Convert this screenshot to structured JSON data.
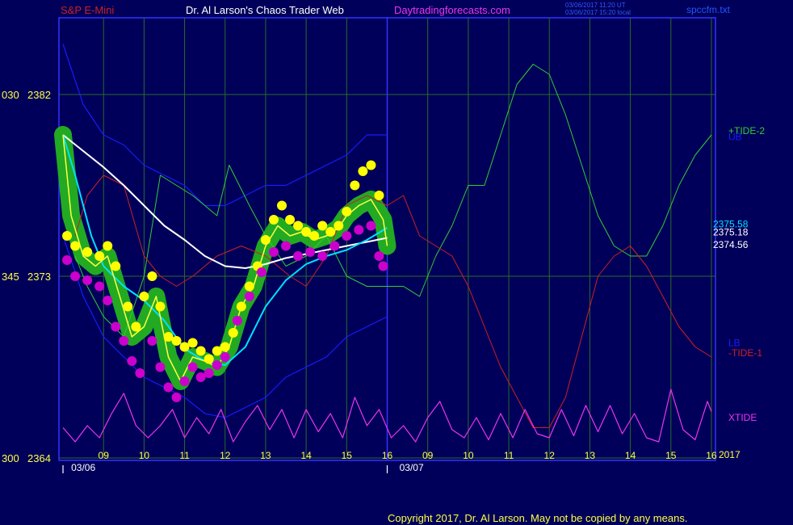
{
  "header": {
    "symbol": "S&P E-Mini",
    "author": "Dr. Al Larson's Chaos Trader Web",
    "site": "Daytradingforecasts.com",
    "stamp1": "03/06/2017 11:20 UT",
    "stamp2": "03/06/2017 15:20 local",
    "file": "spccfm.txt"
  },
  "footer": {
    "copyright": "Copyright 2017, Dr. Al Larson. May not be copied by any means."
  },
  "colors": {
    "background": "#00005a",
    "frame": "#3333ff",
    "grid": "#2a6a2a",
    "tide2": "#33cc33",
    "tide1": "#cc2020",
    "xtide": "#ee33ee",
    "band": "#1a1aff",
    "ma_slow": "#ffffff",
    "ma_mid": "#00e0ff",
    "price": "#ffff44",
    "halo": "#22aa22",
    "high_dot": "#ffff00",
    "low_dot": "#cc00cc"
  },
  "chart_data": {
    "type": "line",
    "y_axis": {
      "ylim": [
        2364,
        2385
      ],
      "ticks": [
        {
          "value": 2382,
          "label": "2382",
          "prefix": "030"
        },
        {
          "value": 2373,
          "label": "2373",
          "prefix": "345"
        },
        {
          "value": 2364,
          "label": "2364",
          "prefix": "300"
        }
      ]
    },
    "x_axis": {
      "xlim": [
        7.9,
        24.1
      ],
      "hour_ticks": [
        {
          "x": 9,
          "label": "09"
        },
        {
          "x": 10,
          "label": "10"
        },
        {
          "x": 11,
          "label": "11"
        },
        {
          "x": 12,
          "label": "12"
        },
        {
          "x": 13,
          "label": "13"
        },
        {
          "x": 14,
          "label": "14"
        },
        {
          "x": 15,
          "label": "15"
        },
        {
          "x": 16,
          "label": "16"
        },
        {
          "x": 17,
          "label": "09"
        },
        {
          "x": 18,
          "label": "10"
        },
        {
          "x": 19,
          "label": "11"
        },
        {
          "x": 20,
          "label": "12"
        },
        {
          "x": 21,
          "label": "13"
        },
        {
          "x": 22,
          "label": "14"
        },
        {
          "x": 23,
          "label": "15"
        },
        {
          "x": 24,
          "label": "16"
        }
      ],
      "date_labels": [
        {
          "x": 8.5,
          "label": "03/06"
        },
        {
          "x": 16.6,
          "label": "03/07"
        }
      ],
      "divider_x": 16,
      "year_label": "2017"
    },
    "value_labels": [
      {
        "value": 2375.58,
        "label": "2375.58",
        "color": "#00e0ff"
      },
      {
        "value": 2375.18,
        "label": "2375.18",
        "color": "#ffffff"
      },
      {
        "value": 2374.56,
        "label": "2374.56",
        "color": "#ffffff"
      }
    ],
    "series": [
      {
        "name": "+TIDE-2",
        "color": "#33cc33",
        "legend_y": 2380.2,
        "x": [
          8.3,
          8.6,
          9.0,
          9.5,
          10.0,
          10.4,
          10.8,
          11.2,
          11.8,
          12.1,
          12.6,
          13.0,
          13.5,
          14.0,
          14.5,
          15.0,
          15.5,
          16.0,
          16.4,
          16.8,
          17.2,
          17.6,
          18.0,
          18.4,
          18.8,
          19.2,
          19.6,
          20.0,
          20.4,
          20.8,
          21.2,
          21.6,
          22.0,
          22.4,
          22.8,
          23.2,
          23.6,
          24.0
        ],
        "y": [
          2374.0,
          2372.5,
          2371.0,
          2370.0,
          2373.0,
          2378.0,
          2377.5,
          2377.0,
          2376.0,
          2378.5,
          2376.5,
          2375.0,
          2373.5,
          2374.0,
          2375.0,
          2373.0,
          2372.5,
          2372.5,
          2372.5,
          2372.0,
          2374.0,
          2375.5,
          2377.5,
          2377.5,
          2380.0,
          2382.5,
          2383.5,
          2383.0,
          2381.0,
          2378.5,
          2376.0,
          2374.5,
          2374.0,
          2374.0,
          2375.5,
          2377.5,
          2379.0,
          2380.0
        ]
      },
      {
        "name": "-TIDE-1",
        "color": "#cc2020",
        "legend_y": 2369.2,
        "x": [
          8.3,
          8.6,
          9.0,
          9.5,
          10.0,
          10.4,
          10.8,
          11.2,
          11.8,
          12.4,
          13.0,
          13.6,
          14.0,
          14.5,
          15.0,
          15.5,
          16.0,
          16.4,
          16.8,
          17.2,
          17.6,
          18.0,
          18.4,
          18.8,
          19.2,
          19.6,
          20.0,
          20.4,
          20.8,
          21.2,
          21.6,
          22.0,
          22.4,
          22.8,
          23.2,
          23.6,
          24.0
        ],
        "y": [
          2375.0,
          2377.0,
          2378.0,
          2377.5,
          2374.0,
          2373.0,
          2372.5,
          2373.0,
          2374.0,
          2374.5,
          2374.0,
          2373.0,
          2372.5,
          2374.0,
          2376.5,
          2377.0,
          2376.5,
          2377.0,
          2375.0,
          2374.5,
          2374.0,
          2372.5,
          2370.5,
          2368.5,
          2367.0,
          2365.5,
          2365.5,
          2367.0,
          2370.0,
          2373.0,
          2374.0,
          2374.5,
          2373.5,
          2372.0,
          2370.5,
          2369.5,
          2369.0
        ]
      },
      {
        "name": "XTIDE",
        "color": "#ee33ee",
        "legend_y": 2366.0,
        "x": [
          8.0,
          8.3,
          8.6,
          8.9,
          9.2,
          9.5,
          9.8,
          10.1,
          10.4,
          10.7,
          11.0,
          11.3,
          11.6,
          11.9,
          12.2,
          12.5,
          12.8,
          13.1,
          13.4,
          13.7,
          14.0,
          14.3,
          14.6,
          14.9,
          15.2,
          15.5,
          15.8,
          16.1,
          16.4,
          16.7,
          17.0,
          17.3,
          17.6,
          17.9,
          18.2,
          18.5,
          18.8,
          19.1,
          19.4,
          19.7,
          20.0,
          20.3,
          20.6,
          20.9,
          21.2,
          21.5,
          21.8,
          22.1,
          22.4,
          22.7,
          23.0,
          23.3,
          23.6,
          23.9,
          24.0
        ],
        "y": [
          2365.5,
          2364.8,
          2365.6,
          2365.0,
          2366.2,
          2367.2,
          2365.6,
          2365.0,
          2365.6,
          2366.4,
          2365.0,
          2366.0,
          2365.2,
          2366.4,
          2364.8,
          2365.8,
          2366.6,
          2365.4,
          2366.4,
          2365.0,
          2366.4,
          2365.3,
          2366.2,
          2365.0,
          2367.0,
          2365.6,
          2366.4,
          2365.0,
          2365.6,
          2364.8,
          2366.0,
          2366.8,
          2365.4,
          2365.0,
          2366.0,
          2364.9,
          2366.2,
          2365.0,
          2366.4,
          2365.2,
          2365.0,
          2366.4,
          2365.1,
          2366.6,
          2365.3,
          2366.6,
          2365.2,
          2366.2,
          2365.0,
          2364.8,
          2367.4,
          2365.4,
          2364.9,
          2366.8,
          2366.3
        ]
      },
      {
        "name": "UB",
        "color": "#1a1aff",
        "legend_y": 2379.9,
        "x": [
          8.0,
          8.5,
          9.0,
          9.5,
          10.0,
          10.5,
          11.0,
          11.5,
          12.0,
          12.5,
          13.0,
          13.5,
          14.0,
          14.5,
          15.0,
          15.5,
          16.0
        ],
        "y": [
          2384.5,
          2381.5,
          2380.0,
          2379.5,
          2378.5,
          2378.0,
          2377.5,
          2376.5,
          2376.5,
          2377.0,
          2377.5,
          2377.5,
          2378.0,
          2378.5,
          2379.0,
          2380.0,
          2380.0
        ]
      },
      {
        "name": "LB",
        "color": "#1a1aff",
        "legend_y": 2369.7,
        "x": [
          8.0,
          8.5,
          9.0,
          9.5,
          10.0,
          10.5,
          11.0,
          11.5,
          12.0,
          12.5,
          13.0,
          13.5,
          14.0,
          14.5,
          15.0,
          15.5,
          16.0
        ],
        "y": [
          2375.0,
          2372.0,
          2370.0,
          2369.0,
          2368.0,
          2367.5,
          2367.0,
          2366.2,
          2366.0,
          2366.5,
          2367.0,
          2368.0,
          2368.5,
          2369.0,
          2370.0,
          2370.5,
          2371.0
        ]
      },
      {
        "name": "",
        "color": "#ffffff",
        "x": [
          8.0,
          8.5,
          9.0,
          9.5,
          10.0,
          10.5,
          11.0,
          11.5,
          12.0,
          12.5,
          13.0,
          13.5,
          14.0,
          14.5,
          15.0,
          15.5,
          16.0
        ],
        "y": [
          2380.0,
          2379.2,
          2378.4,
          2377.5,
          2376.5,
          2375.5,
          2374.8,
          2374.0,
          2373.5,
          2373.4,
          2373.6,
          2373.9,
          2374.1,
          2374.3,
          2374.5,
          2374.7,
          2374.9
        ]
      },
      {
        "name": "",
        "color": "#00e0ff",
        "x": [
          8.0,
          8.3,
          8.7,
          9.0,
          9.5,
          10.0,
          10.5,
          11.0,
          11.5,
          12.0,
          12.5,
          13.0,
          13.5,
          14.0,
          14.5,
          15.0,
          15.5,
          16.0
        ],
        "y": [
          2380.0,
          2378.0,
          2375.0,
          2373.5,
          2372.5,
          2371.8,
          2370.8,
          2369.4,
          2368.8,
          2368.6,
          2369.5,
          2371.5,
          2372.8,
          2373.6,
          2374.0,
          2374.3,
          2374.8,
          2375.4
        ]
      },
      {
        "name": "",
        "color": "#ffff44",
        "x": [
          8.0,
          8.2,
          8.5,
          8.8,
          9.1,
          9.4,
          9.7,
          10.0,
          10.3,
          10.6,
          10.9,
          11.2,
          11.5,
          11.8,
          12.1,
          12.4,
          12.7,
          13.0,
          13.3,
          13.6,
          13.9,
          14.2,
          14.5,
          14.8,
          15.0,
          15.3,
          15.6,
          15.9,
          16.0
        ],
        "y": [
          2380.0,
          2376.0,
          2374.0,
          2373.5,
          2374.0,
          2372.0,
          2370.0,
          2370.5,
          2372.0,
          2369.0,
          2367.8,
          2369.0,
          2368.8,
          2368.5,
          2369.5,
          2371.5,
          2372.5,
          2374.5,
          2375.5,
          2375.0,
          2375.2,
          2374.8,
          2375.0,
          2375.4,
          2376.0,
          2376.5,
          2376.8,
          2375.8,
          2374.5
        ]
      }
    ],
    "highs": [
      [
        8.1,
        2375.0
      ],
      [
        8.3,
        2374.5
      ],
      [
        8.6,
        2374.2
      ],
      [
        8.9,
        2374.0
      ],
      [
        9.1,
        2374.5
      ],
      [
        9.3,
        2373.5
      ],
      [
        9.6,
        2371.5
      ],
      [
        9.8,
        2370.5
      ],
      [
        10.0,
        2372.0
      ],
      [
        10.2,
        2373.0
      ],
      [
        10.4,
        2371.5
      ],
      [
        10.6,
        2370.0
      ],
      [
        10.8,
        2369.8
      ],
      [
        11.0,
        2369.5
      ],
      [
        11.2,
        2369.7
      ],
      [
        11.4,
        2369.3
      ],
      [
        11.6,
        2368.9
      ],
      [
        11.8,
        2369.3
      ],
      [
        12.0,
        2369.5
      ],
      [
        12.2,
        2370.2
      ],
      [
        12.4,
        2371.5
      ],
      [
        12.6,
        2372.5
      ],
      [
        12.8,
        2373.5
      ],
      [
        13.0,
        2374.8
      ],
      [
        13.2,
        2375.8
      ],
      [
        13.4,
        2376.5
      ],
      [
        13.6,
        2375.8
      ],
      [
        13.8,
        2375.5
      ],
      [
        14.0,
        2375.2
      ],
      [
        14.2,
        2375.0
      ],
      [
        14.4,
        2375.5
      ],
      [
        14.6,
        2375.2
      ],
      [
        14.8,
        2375.5
      ],
      [
        15.0,
        2376.2
      ],
      [
        15.2,
        2377.5
      ],
      [
        15.4,
        2378.2
      ],
      [
        15.6,
        2378.5
      ],
      [
        15.8,
        2377.0
      ]
    ],
    "lows": [
      [
        8.1,
        2373.8
      ],
      [
        8.3,
        2373.0
      ],
      [
        8.6,
        2372.8
      ],
      [
        8.9,
        2372.5
      ],
      [
        9.1,
        2371.8
      ],
      [
        9.3,
        2370.5
      ],
      [
        9.5,
        2369.8
      ],
      [
        9.7,
        2368.8
      ],
      [
        9.9,
        2368.2
      ],
      [
        10.2,
        2369.8
      ],
      [
        10.4,
        2368.5
      ],
      [
        10.6,
        2367.5
      ],
      [
        10.8,
        2367.0
      ],
      [
        11.0,
        2367.8
      ],
      [
        11.2,
        2368.5
      ],
      [
        11.4,
        2368.0
      ],
      [
        11.6,
        2368.2
      ],
      [
        11.8,
        2368.6
      ],
      [
        12.0,
        2369.0
      ],
      [
        12.3,
        2370.8
      ],
      [
        12.6,
        2372.0
      ],
      [
        12.9,
        2373.2
      ],
      [
        13.2,
        2374.2
      ],
      [
        13.5,
        2374.5
      ],
      [
        13.8,
        2374.0
      ],
      [
        14.1,
        2374.2
      ],
      [
        14.4,
        2374.0
      ],
      [
        14.7,
        2374.5
      ],
      [
        15.0,
        2375.0
      ],
      [
        15.3,
        2375.3
      ],
      [
        15.6,
        2375.5
      ],
      [
        15.8,
        2374.0
      ],
      [
        15.9,
        2373.5
      ]
    ]
  }
}
